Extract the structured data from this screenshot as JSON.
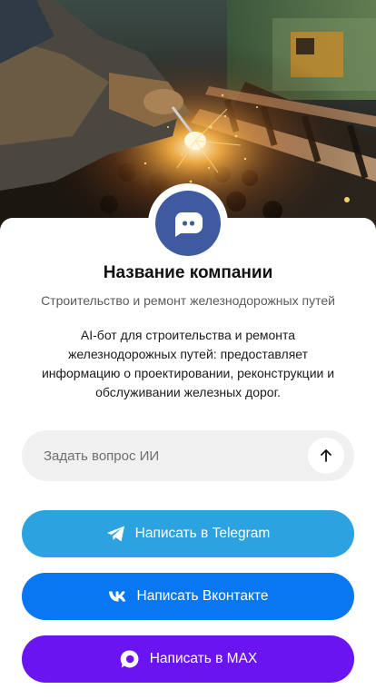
{
  "company": {
    "name": "Название компании",
    "subtitle": "Строительство и ремонт железнодорожных путей",
    "description": "AI-бот для строительства и ремонта железнодорожных путей: предоставляет информацию о проектировании, реконструкции и обслуживании железных дорог."
  },
  "hero": {
    "image": "welder-on-railway-tracks"
  },
  "avatar": {
    "icon": "chat-bot-icon",
    "color": "#3f5aa0"
  },
  "ask": {
    "placeholder": "Задать вопрос ИИ",
    "value": "",
    "send_icon": "arrow-up-icon"
  },
  "buttons": [
    {
      "label": "Написать в Telegram",
      "icon": "telegram-icon",
      "color": "#2ca2e0"
    },
    {
      "label": "Написать Вконтакте",
      "icon": "vk-icon",
      "color": "#0a77f2"
    },
    {
      "label": "Написать в MAX",
      "icon": "max-icon",
      "color": "#6a14f1"
    }
  ]
}
